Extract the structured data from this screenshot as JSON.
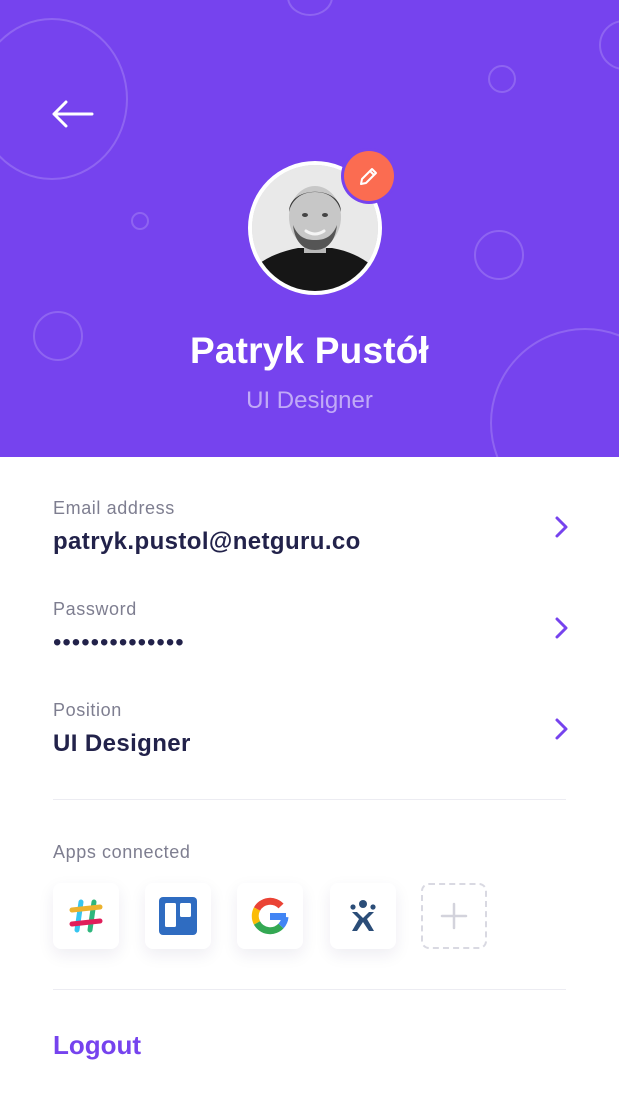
{
  "profile": {
    "name": "Patryk Pustół",
    "role": "UI Designer"
  },
  "fields": {
    "email": {
      "label": "Email address",
      "value": "patryk.pustol@netguru.co"
    },
    "password": {
      "label": "Password",
      "value": "••••••••••••••"
    },
    "position": {
      "label": "Position",
      "value": "UI Designer"
    }
  },
  "apps": {
    "label": "Apps connected",
    "items": [
      "slack-icon",
      "trello-icon",
      "google-icon",
      "jira-icon"
    ]
  },
  "actions": {
    "logout": "Logout"
  },
  "colors": {
    "brand": "#7643EE",
    "edit": "#FB6C51",
    "text": "#22224A",
    "muted": "#7E7E90"
  }
}
